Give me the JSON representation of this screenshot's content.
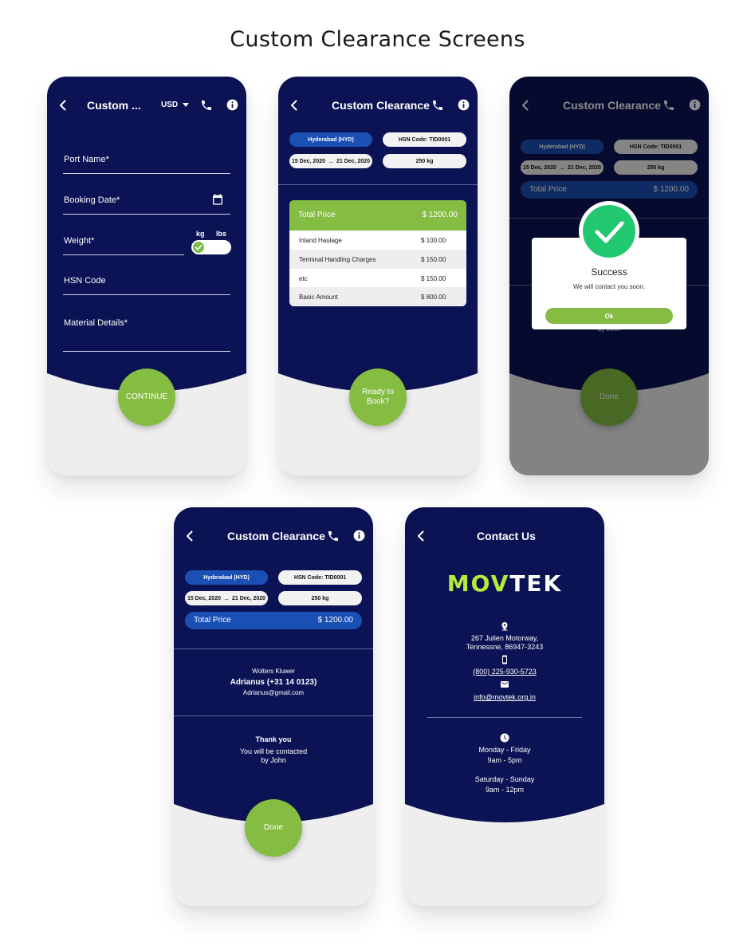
{
  "page_title": "Custom Clearance Screens",
  "colors": {
    "navy": "#0b1354",
    "green": "#84bd41",
    "chip_blue": "#1a4fb4",
    "success": "#22c870",
    "light_bg": "#eeeeee"
  },
  "screen1": {
    "title": "Custom ...",
    "currency": "USD",
    "fields": {
      "port_name": "Port Name*",
      "booking_date": "Booking Date*",
      "weight": "Weight*",
      "hsn_code": "HSN Code",
      "material_details": "Material Details*"
    },
    "unit_kg": "kg",
    "unit_lbs": "lbs",
    "button": "CONTINUE"
  },
  "screen2": {
    "title": "Custom Clearance",
    "chips": {
      "port": "Hyderabad (HYD)",
      "hsn": "HSN Code: TID0001",
      "date_from": "15 Dec, 2020",
      "date_to": "21 Dec, 2020",
      "weight": "250 kg"
    },
    "total_label": "Total Price",
    "total_value": "$ 1200.00",
    "rows": [
      {
        "label": "Inland Haulage",
        "value": "$ 100.00"
      },
      {
        "label": "Terminal Handling Charges",
        "value": "$ 150.00"
      },
      {
        "label": "etc",
        "value": "$ 150.00"
      },
      {
        "label": "Basic Amount",
        "value": "$ 800.00"
      }
    ],
    "button_line1": "Ready to",
    "button_line2": "Book?"
  },
  "screen3": {
    "title": "Custom Clearance",
    "chips": {
      "port": "Hyderabad (HYD)",
      "hsn": "HSN Code: TID0001",
      "date_from": "15 Dec, 2020",
      "date_to": "21 Dec, 2020",
      "weight": "250 kg"
    },
    "total_label": "Total Price",
    "total_value": "$ 1200.00",
    "behind_text": "by John",
    "dialog_title": "Success",
    "dialog_message": "We will contact you soon.",
    "ok_label": "Ok",
    "button": "Done"
  },
  "screen4": {
    "title": "Custom Clearance",
    "chips": {
      "port": "Hyderabad (HYD)",
      "hsn": "HSN Code: TID0001",
      "date_from": "15 Dec, 2020",
      "date_to": "21 Dec, 2020",
      "weight": "250 kg"
    },
    "total_label": "Total Price",
    "total_value": "$ 1200.00",
    "company": "Wolters Kluwer",
    "contact_name": "Adrianus (+31 14 0123)",
    "contact_email": "Adrianus@gmail.com",
    "thanks_title": "Thank you",
    "thanks_line1": "You will be contacted",
    "thanks_line2": "by John",
    "button": "Done"
  },
  "screen5": {
    "title": "Contact Us",
    "logo_mov": "MOV",
    "logo_tek": "TEK",
    "address_line1": "267 Julien Motorway,",
    "address_line2": "Tennessne, 86947-3243",
    "phone": "(800) 225-930-5723",
    "email": "info@movtek.org.in",
    "weekday_days": "Monday - Friday",
    "weekday_hours": "9am - 5pm",
    "weekend_days": "Saturday - Sunday",
    "weekend_hours": "9am - 12pm"
  }
}
